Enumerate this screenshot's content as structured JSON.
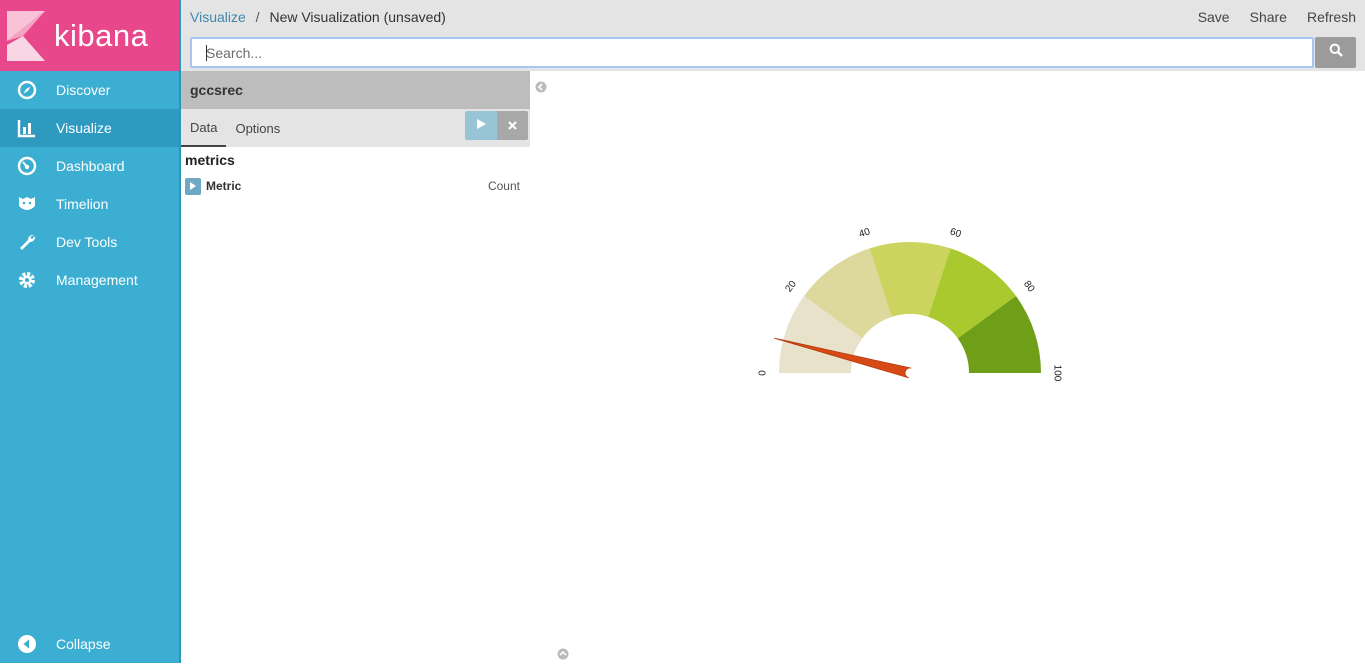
{
  "brand": {
    "name": "kibana",
    "color": "#e8488b"
  },
  "sidebar": {
    "items": [
      {
        "label": "Discover",
        "icon": "compass-icon"
      },
      {
        "label": "Visualize",
        "icon": "bar-chart-icon",
        "active": true
      },
      {
        "label": "Dashboard",
        "icon": "dashboard-icon"
      },
      {
        "label": "Timelion",
        "icon": "timelion-icon"
      },
      {
        "label": "Dev Tools",
        "icon": "wrench-icon"
      },
      {
        "label": "Management",
        "icon": "gear-icon"
      }
    ],
    "collapse_label": "Collapse"
  },
  "breadcrumb": {
    "parent": "Visualize",
    "separator": "/",
    "current": "New Visualization (unsaved)"
  },
  "top_menu": {
    "save": "Save",
    "share": "Share",
    "refresh": "Refresh"
  },
  "search": {
    "placeholder": "Search...",
    "value": ""
  },
  "editor": {
    "index_pattern": "gccsrec",
    "tabs": {
      "data": "Data",
      "options": "Options",
      "active": "Data"
    },
    "section_title": "metrics",
    "metric": {
      "label": "Metric",
      "aggregation": "Count"
    }
  },
  "chart_data": {
    "type": "gauge",
    "range": [
      0,
      100
    ],
    "tick_labels": [
      "0",
      "20",
      "40",
      "60",
      "80",
      "100"
    ],
    "bands": [
      {
        "from": 0,
        "to": 20,
        "color": "#e8e2cb"
      },
      {
        "from": 20,
        "to": 40,
        "color": "#ddd89c"
      },
      {
        "from": 40,
        "to": 60,
        "color": "#ccd45f"
      },
      {
        "from": 60,
        "to": 80,
        "color": "#aac92e"
      },
      {
        "from": 80,
        "to": 100,
        "color": "#6f9f19"
      }
    ],
    "needle_value": 8,
    "needle_color": "#d84a15"
  }
}
